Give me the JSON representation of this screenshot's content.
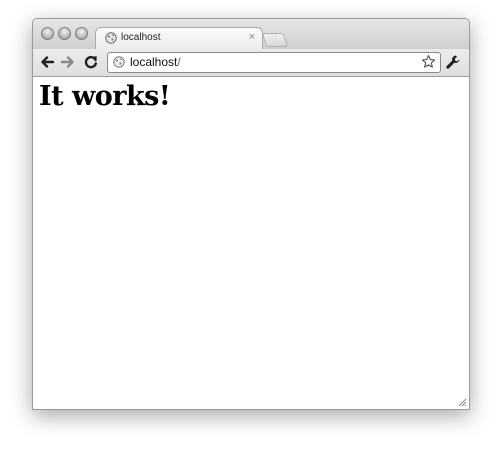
{
  "browser": {
    "tab": {
      "title": "localhost",
      "close_label": "×",
      "favicon": "globe-icon"
    },
    "new_tab_label": "+",
    "toolbar": {
      "back_icon": "back-arrow-icon",
      "forward_icon": "forward-arrow-icon",
      "reload_icon": "reload-icon",
      "bookmark_icon": "star-icon",
      "menu_icon": "wrench-icon"
    },
    "address_bar": {
      "host": "localhost",
      "path": "/"
    }
  },
  "page": {
    "heading": "It works!"
  },
  "colors": {
    "titlebar": "#d6d6d6",
    "window_border": "#9a9a9a",
    "page_background": "#ffffff",
    "heading_text": "#000000"
  }
}
